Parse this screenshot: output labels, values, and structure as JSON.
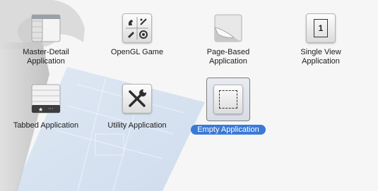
{
  "templates": [
    {
      "label_line1": "Master-Detail",
      "label_line2": "Application",
      "icon": "master-detail-icon",
      "selected": false
    },
    {
      "label_line1": "OpenGL Game",
      "label_line2": "",
      "icon": "opengl-game-icon",
      "selected": false
    },
    {
      "label_line1": "Page-Based",
      "label_line2": "Application",
      "icon": "page-curl-icon",
      "selected": false
    },
    {
      "label_line1": "Single View",
      "label_line2": "Application",
      "icon": "single-view-icon",
      "selected": false
    },
    {
      "label_line1": "Tabbed Application",
      "label_line2": "",
      "icon": "tab-bar-icon",
      "selected": false
    },
    {
      "label_line1": "Utility Application",
      "label_line2": "",
      "icon": "tools-icon",
      "selected": false
    },
    {
      "label_line1": "Empty Application",
      "label_line2": "",
      "icon": "empty-frame-icon",
      "selected": true
    }
  ],
  "single_view_digit": "1",
  "colors": {
    "selection": "#3a7ad7",
    "background": "#f6f6f6"
  }
}
